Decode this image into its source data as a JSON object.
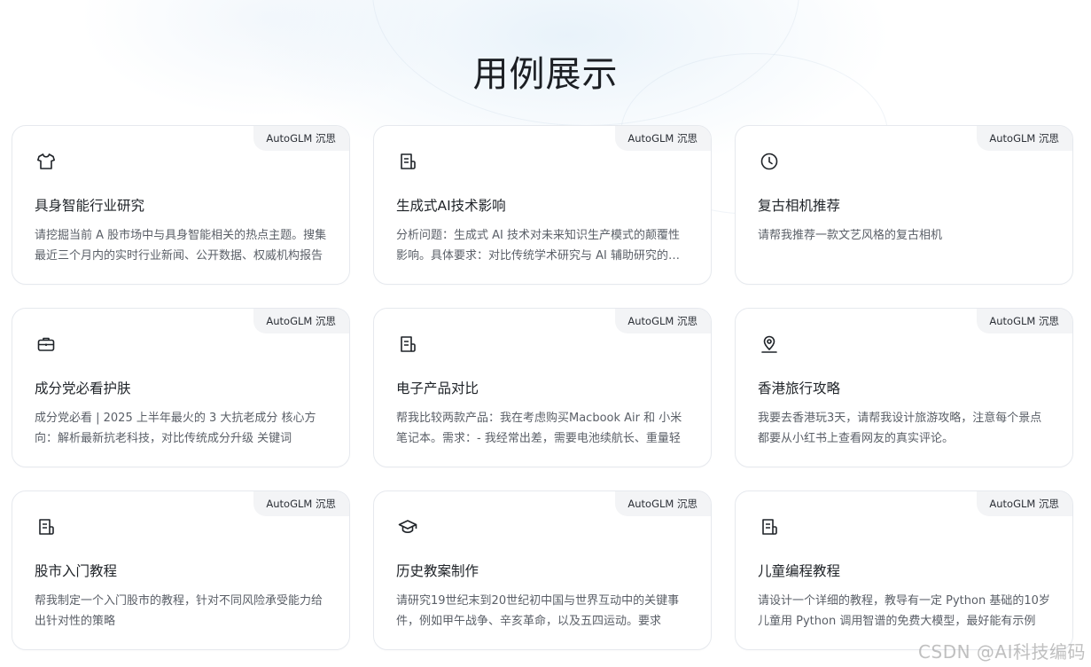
{
  "page": {
    "title": "用例展示"
  },
  "cards": [
    {
      "icon": "shirt-icon",
      "badge": "AutoGLM 沉思",
      "title": "具身智能行业研究",
      "desc": "请挖掘当前 A 股市场中与具身智能相关的热点主题。搜集最近三个月内的实时行业新闻、公开数据、权威机构报告"
    },
    {
      "icon": "document-icon",
      "badge": "AutoGLM 沉思",
      "title": "生成式AI技术影响",
      "desc": "分析问题：生成式 AI 技术对未来知识生产模式的颠覆性影响。具体要求：对比传统学术研究与 AI 辅助研究的差异"
    },
    {
      "icon": "clock-icon",
      "badge": "AutoGLM 沉思",
      "title": "复古相机推荐",
      "desc": "请帮我推荐一款文艺风格的复古相机"
    },
    {
      "icon": "briefcase-icon",
      "badge": "AutoGLM 沉思",
      "title": "成分党必看护肤",
      "desc": "成分党必看 | 2025 上半年最火的 3 大抗老成分 核心方向：解析最新抗老科技，对比传统成分升级 关键词"
    },
    {
      "icon": "document-icon",
      "badge": "AutoGLM 沉思",
      "title": "电子产品对比",
      "desc": "帮我比较两款产品：我在考虑购买Macbook Air 和 小米笔记本。需求：- 我经常出差，需要电池续航长、重量轻"
    },
    {
      "icon": "location-pin-icon",
      "badge": "AutoGLM 沉思",
      "title": "香港旅行攻略",
      "desc": "我要去香港玩3天，请帮我设计旅游攻略，注意每个景点都要从小红书上查看网友的真实评论。"
    },
    {
      "icon": "document-icon",
      "badge": "AutoGLM 沉思",
      "title": "股市入门教程",
      "desc": "帮我制定一个入门股市的教程，针对不同风险承受能力给出针对性的策略"
    },
    {
      "icon": "graduation-cap-icon",
      "badge": "AutoGLM 沉思",
      "title": "历史教案制作",
      "desc": "请研究19世纪末到20世纪初中国与世界互动中的关键事件，例如甲午战争、辛亥革命，以及五四运动。要求"
    },
    {
      "icon": "document-icon",
      "badge": "AutoGLM 沉思",
      "title": "儿童编程教程",
      "desc": "请设计一个详细的教程，教导有一定 Python 基础的10岁儿童用 Python 调用智谱的免费大模型，最好能有示例"
    }
  ],
  "watermark": "CSDN @AI科技编码"
}
